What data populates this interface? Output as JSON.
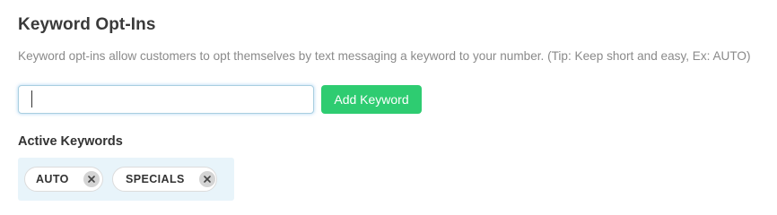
{
  "section": {
    "title": "Keyword Opt-Ins",
    "description": "Keyword opt-ins allow customers to opt themselves by text messaging a keyword to your number. (Tip: Keep short and easy, Ex: AUTO)"
  },
  "input": {
    "value": "",
    "placeholder": ""
  },
  "add_button": {
    "label": "Add Keyword"
  },
  "active_keywords": {
    "heading": "Active Keywords",
    "items": [
      {
        "label": "AUTO",
        "remove_icon": "close-icon"
      },
      {
        "label": "SPECIALS",
        "remove_icon": "close-icon"
      }
    ]
  },
  "colors": {
    "accent_green": "#2ecc71",
    "keywords_background": "#e8f4fa",
    "input_focus_border": "#a9cfe0",
    "description_text": "#8a8a8a"
  }
}
